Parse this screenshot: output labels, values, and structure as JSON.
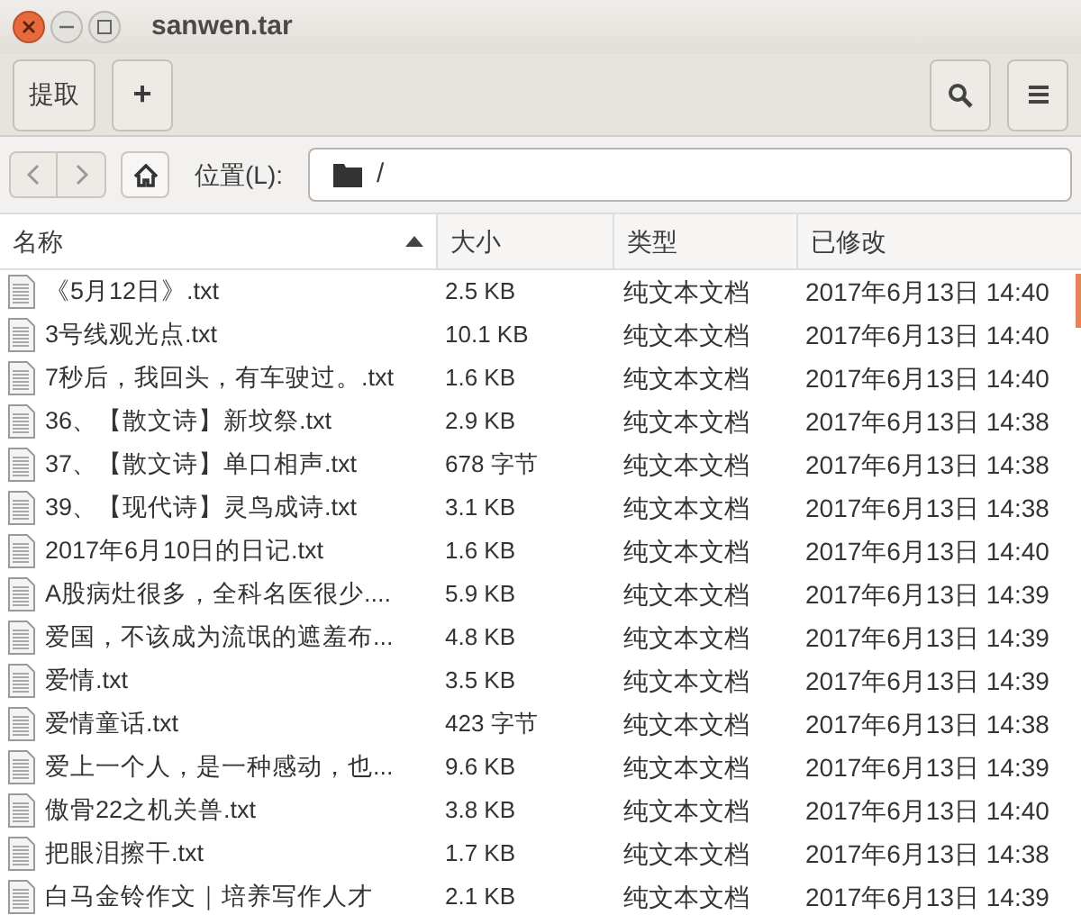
{
  "window": {
    "title": "sanwen.tar"
  },
  "toolbar": {
    "extract_button": "提取",
    "add_button": "+"
  },
  "location": {
    "label": "位置(L):",
    "path": "/"
  },
  "table": {
    "columns": [
      {
        "label": "名称",
        "sorted": true
      },
      {
        "label": "大小",
        "sorted": false
      },
      {
        "label": "类型",
        "sorted": false
      },
      {
        "label": "已修改",
        "sorted": false
      }
    ],
    "rows": [
      {
        "name": "《5月12日》.txt",
        "size": "2.5 KB",
        "type": "纯文本文档",
        "modified": "2017年6月13日 14:40"
      },
      {
        "name": "3号线观光点.txt",
        "size": "10.1 KB",
        "type": "纯文本文档",
        "modified": "2017年6月13日 14:40"
      },
      {
        "name": "7秒后，我回头，有车驶过。.txt",
        "size": "1.6 KB",
        "type": "纯文本文档",
        "modified": "2017年6月13日 14:40"
      },
      {
        "name": "36、【散文诗】新坟祭.txt",
        "size": "2.9 KB",
        "type": "纯文本文档",
        "modified": "2017年6月13日 14:38"
      },
      {
        "name": "37、【散文诗】单口相声.txt",
        "size": "678 字节",
        "type": "纯文本文档",
        "modified": "2017年6月13日 14:38"
      },
      {
        "name": "39、【现代诗】灵鸟成诗.txt",
        "size": "3.1 KB",
        "type": "纯文本文档",
        "modified": "2017年6月13日 14:38"
      },
      {
        "name": "2017年6月10日的日记.txt",
        "size": "1.6 KB",
        "type": "纯文本文档",
        "modified": "2017年6月13日 14:40"
      },
      {
        "name": "A股病灶很多，全科名医很少....",
        "size": "5.9 KB",
        "type": "纯文本文档",
        "modified": "2017年6月13日 14:39"
      },
      {
        "name": "爱国，不该成为流氓的遮羞布...",
        "size": "4.8 KB",
        "type": "纯文本文档",
        "modified": "2017年6月13日 14:39"
      },
      {
        "name": "爱情.txt",
        "size": "3.5 KB",
        "type": "纯文本文档",
        "modified": "2017年6月13日 14:39"
      },
      {
        "name": "爱情童话.txt",
        "size": "423 字节",
        "type": "纯文本文档",
        "modified": "2017年6月13日 14:38"
      },
      {
        "name": "爱上一个人，是一种感动，也...",
        "size": "9.6 KB",
        "type": "纯文本文档",
        "modified": "2017年6月13日 14:39"
      },
      {
        "name": "傲骨22之机关兽.txt",
        "size": "3.8 KB",
        "type": "纯文本文档",
        "modified": "2017年6月13日 14:40"
      },
      {
        "name": "把眼泪擦干.txt",
        "size": "1.7 KB",
        "type": "纯文本文档",
        "modified": "2017年6月13日 14:38"
      },
      {
        "name": "白马金铃作文｜培养写作人才",
        "size": "2.1 KB",
        "type": "纯文本文档",
        "modified": "2017年6月13日 14:39"
      }
    ]
  }
}
